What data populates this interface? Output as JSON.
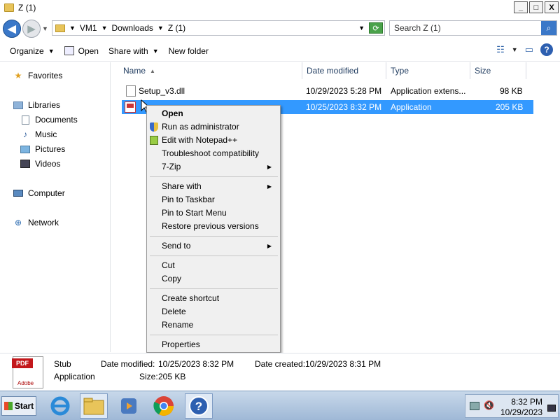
{
  "window": {
    "title": "Z (1)",
    "min": "_",
    "max": "□",
    "close": "X"
  },
  "address": {
    "crumbs": [
      "VM1",
      "Downloads",
      "Z (1)"
    ],
    "search_placeholder": "Search Z (1)"
  },
  "toolbar": {
    "organize": "Organize",
    "open": "Open",
    "share_with": "Share with",
    "new_folder": "New folder"
  },
  "nav": {
    "favorites": "Favorites",
    "libraries": "Libraries",
    "documents": "Documents",
    "music": "Music",
    "pictures": "Pictures",
    "videos": "Videos",
    "computer": "Computer",
    "network": "Network"
  },
  "columns": {
    "name": "Name",
    "date": "Date modified",
    "type": "Type",
    "size": "Size"
  },
  "files": [
    {
      "name": "Setup_v3.dll",
      "date": "10/29/2023 5:28 PM",
      "type": "Application extens...",
      "size": "98 KB"
    },
    {
      "name": "Stub",
      "date": "10/25/2023 8:32 PM",
      "type": "Application",
      "size": "205 KB"
    }
  ],
  "context_menu": {
    "open": "Open",
    "run_admin": "Run as administrator",
    "edit_npp": "Edit with Notepad++",
    "troubleshoot": "Troubleshoot compatibility",
    "seven_zip": "7-Zip",
    "share_with": "Share with",
    "pin_taskbar": "Pin to Taskbar",
    "pin_start": "Pin to Start Menu",
    "restore": "Restore previous versions",
    "send_to": "Send to",
    "cut": "Cut",
    "copy": "Copy",
    "create_shortcut": "Create shortcut",
    "delete": "Delete",
    "rename": "Rename",
    "properties": "Properties"
  },
  "details": {
    "pdf_tag": "PDF",
    "adobe": "Adobe",
    "name": "Stub",
    "type": "Application",
    "modified_label": "Date modified:",
    "modified": "10/25/2023 8:32 PM",
    "created_label": "Date created:",
    "created": "10/29/2023 8:31 PM",
    "size_label": "Size:",
    "size": "205 KB"
  },
  "taskbar": {
    "start": "Start",
    "time": "8:32 PM",
    "date": "10/29/2023"
  },
  "colors": {
    "selection": "#3399ff",
    "accent": "#3b78c8"
  }
}
